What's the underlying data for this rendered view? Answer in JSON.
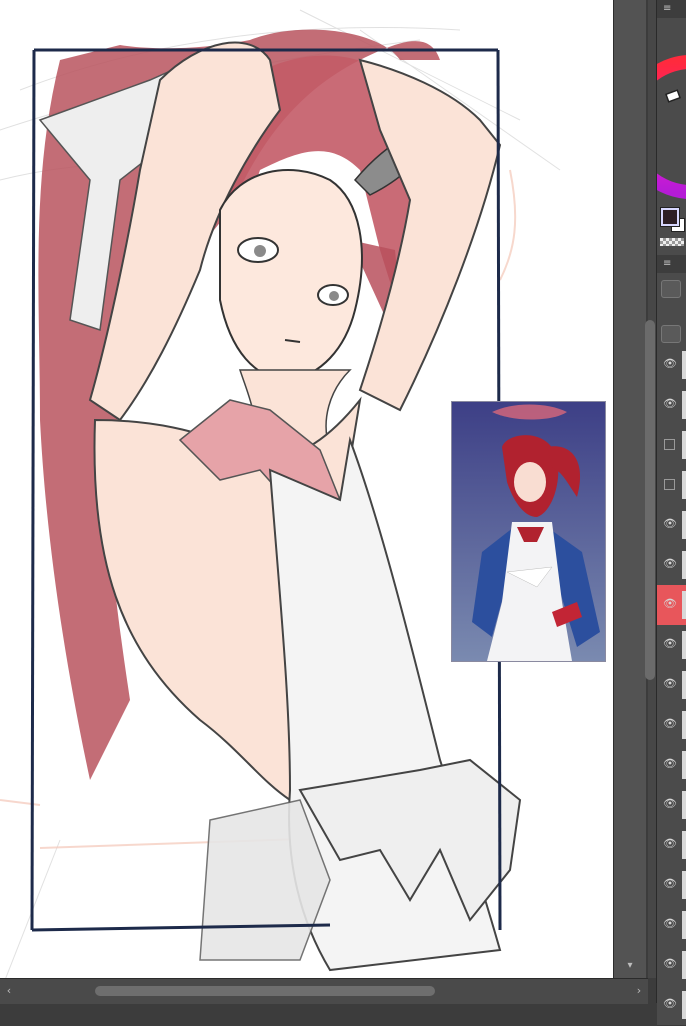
{
  "canvas": {
    "reference_image": "character-reference"
  },
  "panel": {
    "menu_icon": "≡",
    "eye_glyph": "👁",
    "layers": [
      {
        "type": "eye",
        "selected": false
      },
      {
        "type": "eye",
        "selected": false
      },
      {
        "type": "checkbox",
        "selected": false
      },
      {
        "type": "checkbox",
        "selected": false
      },
      {
        "type": "eye",
        "selected": false
      },
      {
        "type": "eye",
        "selected": false
      },
      {
        "type": "eye",
        "selected": true
      },
      {
        "type": "eye",
        "selected": false
      },
      {
        "type": "eye",
        "selected": false
      },
      {
        "type": "eye",
        "selected": false
      },
      {
        "type": "eye",
        "selected": false
      },
      {
        "type": "eye",
        "selected": false
      },
      {
        "type": "eye",
        "selected": false
      },
      {
        "type": "eye",
        "selected": false
      },
      {
        "type": "eye",
        "selected": false
      },
      {
        "type": "eye",
        "selected": false
      },
      {
        "type": "eye",
        "selected": false
      }
    ]
  },
  "colors": {
    "main_color": "#2d1f26",
    "sub_color": "#ffffff",
    "selected_layer": "#e8565b"
  },
  "scrollbar": {
    "left_arrow": "‹",
    "right_arrow": "›",
    "down_arrow": "▾"
  }
}
